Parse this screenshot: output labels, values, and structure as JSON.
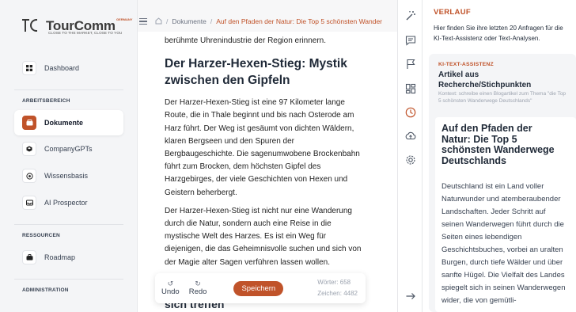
{
  "brand": {
    "name": "TourComm",
    "tagline": "CLOSE TO THE MARKET, CLOSE TO YOU",
    "country": "GERMANY"
  },
  "sidebar": {
    "items_top": [
      {
        "label": "Dashboard",
        "icon": "grid-icon"
      }
    ],
    "sections": [
      {
        "title": "ARBEITSBEREICH",
        "items": [
          {
            "label": "Dokumente",
            "icon": "document-icon",
            "active": true
          },
          {
            "label": "CompanyGPTs",
            "icon": "cube-icon"
          },
          {
            "label": "Wissensbasis",
            "icon": "brain-icon"
          },
          {
            "label": "AI Prospector",
            "icon": "inbox-icon"
          }
        ]
      },
      {
        "title": "RESSOURCEN",
        "items": [
          {
            "label": "Roadmap",
            "icon": "briefcase-icon"
          }
        ]
      },
      {
        "title": "ADMINISTRATION",
        "items": []
      }
    ]
  },
  "breadcrumb": {
    "root": "Dokumente",
    "current": "Auf den Pfaden der Natur: Die Top 5 schönsten Wander"
  },
  "document": {
    "intro_line": "berühmte Uhrenindustrie der Region erinnern.",
    "heading": "Der Harzer-Hexen-Stieg: Mystik zwischen den Gipfeln",
    "paragraph1": "Der Harzer-Hexen-Stieg ist eine 97 Kilometer lange Route, die in Thale beginnt und bis nach Osterode am Harz führt. Der Weg ist gesäumt von dichten Wäldern, klaren Bergseen und den Spuren der Bergbaugeschichte. Die sagenumwobene Brockenbahn führt zum Brocken, dem höchsten Gipfel des Harzgebirges, der viele Geschichten von Hexen und Geistern beherbergt.",
    "paragraph2": "Der Harzer-Hexen-Stieg ist nicht nur eine Wanderung durch die Natur, sondern auch eine Reise in die mystische Welt des Harzes. Es ist ein Weg für diejenigen, die das Geheimnisvolle suchen und sich von der Magie alter Sagen verführen lassen wollen.",
    "cut_heading": "sich treffen"
  },
  "toolbar": {
    "undo_label": "Undo",
    "redo_label": "Redo",
    "save_label": "Speichern",
    "words_label": "Wörter: 658",
    "chars_label": "Zeichen: 4482"
  },
  "history": {
    "title": "VERLAUF",
    "description": "Hier finden Sie ihre letzten 20 Anfragen für die KI-Text-Assistenz oder Text-Analysen.",
    "card": {
      "tag": "KI-TEXT-ASSISTENZ",
      "title": "Artikel aus Recherche/Stichpunkten",
      "context": "Kontext: schreibe einen Blogartikel zum Thema \"die Top 5 schönsten Wanderwege Deutschlands\"",
      "result_title": "Auf den Pfaden der Natur: Die Top 5 schönsten Wanderwege Deutschlands",
      "result_text": "Deutschland ist ein Land voller Naturwunder und atemberaubender Landschaften. Jeder Schritt auf seinen Wanderwegen führt durch die Seiten eines lebendigen Geschichtsbuches, vorbei an uralten Burgen, durch tiefe Wälder und über sanfte Hügel. Die Vielfalt des Landes spiegelt sich in seinen Wanderwegen wider, die von gemütli-"
    }
  },
  "icons": {
    "strip": [
      "magic-wand-icon",
      "chat-icon",
      "flag-icon",
      "layout-icon",
      "clock-icon",
      "cloud-upload-icon",
      "gear-icon",
      "arrow-right-icon"
    ]
  },
  "colors": {
    "accent": "#c0532a"
  }
}
